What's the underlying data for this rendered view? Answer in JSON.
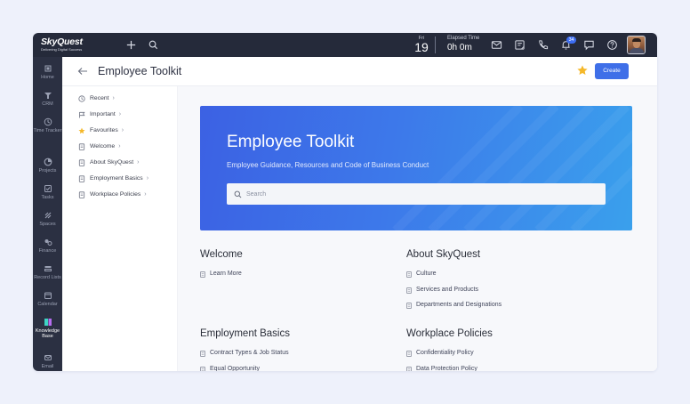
{
  "app": {
    "logo_name": "SkyQuest",
    "logo_tagline": "Delivering Digital Success"
  },
  "topbar": {
    "day_name": "Fri",
    "day_number": "19",
    "elapsed_label": "Elapsed Time",
    "elapsed_value": "0h 0m",
    "notification_count": "34",
    "icons": [
      "plus-icon",
      "search-icon",
      "mail-icon",
      "notes-icon",
      "phone-icon",
      "bell-icon",
      "chat-icon",
      "help-icon"
    ]
  },
  "rail": {
    "items": [
      {
        "label": "Home"
      },
      {
        "label": "CRM"
      },
      {
        "label": "Time Tracker"
      },
      {
        "label": "Projects"
      },
      {
        "label": "Tasks"
      },
      {
        "label": "Spaces"
      },
      {
        "label": "Finance"
      },
      {
        "label": "Record Lists"
      },
      {
        "label": "Calendar"
      },
      {
        "label": "Knowledge Base"
      },
      {
        "label": "Email"
      }
    ],
    "active_index": 9,
    "active_color": "#3fd4c4"
  },
  "header": {
    "title": "Employee Toolkit",
    "create_label": "Create",
    "accent_color": "#3f6fe8",
    "star_color": "#f5b82a"
  },
  "subnav": {
    "items": [
      {
        "label": "Recent",
        "icon": "clock-icon"
      },
      {
        "label": "Important",
        "icon": "flag-icon"
      },
      {
        "label": "Favourites",
        "icon": "star-icon"
      },
      {
        "label": "Welcome",
        "icon": "document-icon"
      },
      {
        "label": "About SkyQuest",
        "icon": "document-icon"
      },
      {
        "label": "Employment Basics",
        "icon": "document-icon"
      },
      {
        "label": "Workplace Policies",
        "icon": "document-icon"
      }
    ],
    "chevron": "›"
  },
  "hero": {
    "title": "Employee Toolkit",
    "subtitle": "Employee Guidance, Resources and Code of Business Conduct",
    "search_placeholder": "Search"
  },
  "sections": [
    {
      "title": "Welcome",
      "links": [
        "Learn More"
      ]
    },
    {
      "title": "About SkyQuest",
      "links": [
        "Culture",
        "Services and Products",
        "Departments and Designations"
      ]
    },
    {
      "title": "Employment Basics",
      "links": [
        "Contract Types & Job Status",
        "Equal Opportunity"
      ]
    },
    {
      "title": "Workplace Policies",
      "links": [
        "Confidentiality Policy",
        "Data Protection Policy"
      ]
    }
  ]
}
